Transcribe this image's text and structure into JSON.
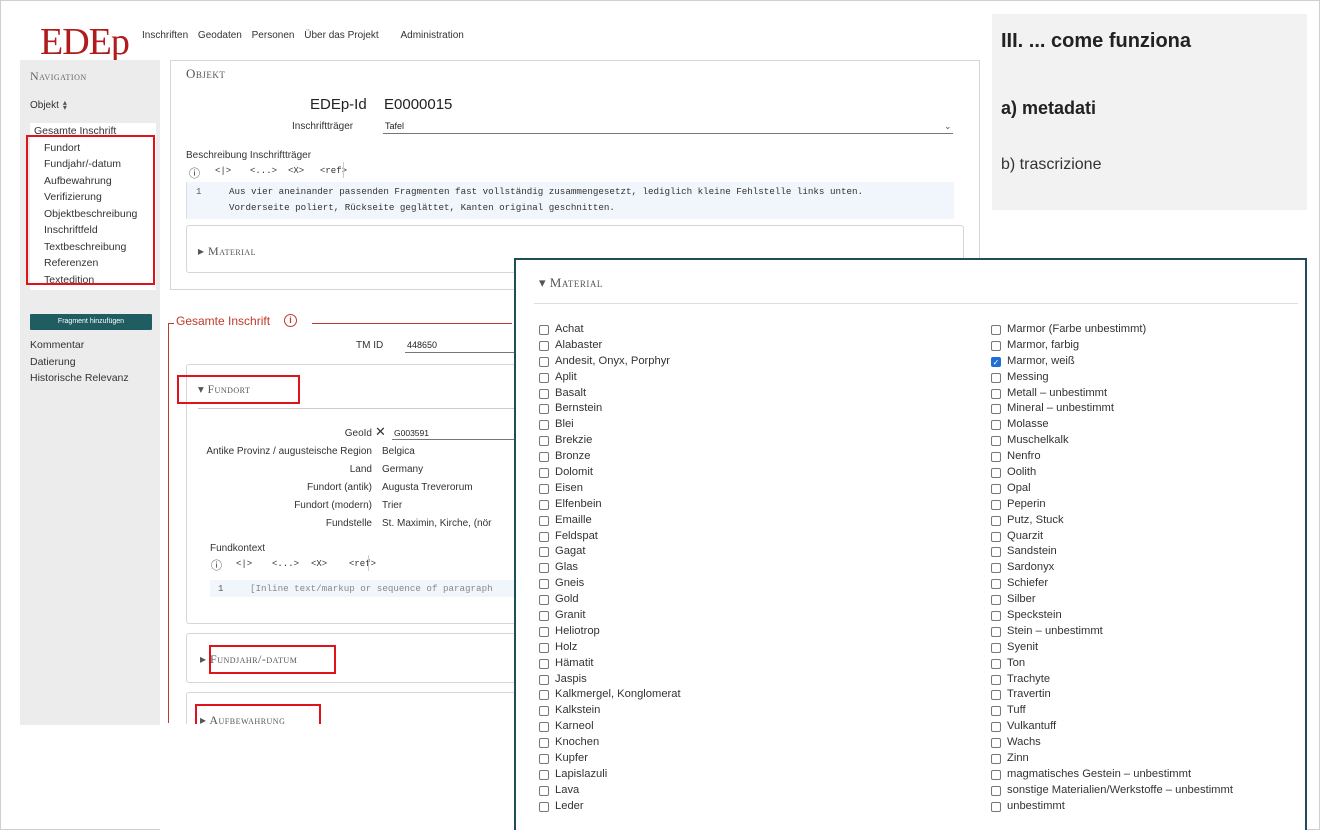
{
  "logo": "EDEp",
  "topnav": [
    "Inschriften",
    "Geodaten",
    "Personen",
    "Über das Projekt",
    "Administration"
  ],
  "sidebar": {
    "title": "Navigation",
    "select_value": "Objekt",
    "items": {
      "gesamte": "Gesamte Inschrift",
      "fundort": "Fundort",
      "fundjahr": "Fundjahr/-datum",
      "aufbewahrung": "Aufbewahrung",
      "verifizierung": "Verifizierung",
      "objektbeschreibung": "Objektbeschreibung",
      "inschriftfeld": "Inschriftfeld",
      "textbeschreibung": "Textbeschreibung",
      "referenzen": "Referenzen",
      "textedition": "Textedition"
    },
    "fragment_button": "Fragment hinzufügen",
    "more": {
      "kommentar": "Kommentar",
      "datierung": "Datierung",
      "historische": "Historische Relevanz"
    }
  },
  "objekt": {
    "title": "Objekt",
    "edep_label": "EDEp-Id",
    "edep_value": "E0000015",
    "trager_label": "Inschriftträger",
    "trager_value": "Tafel",
    "beschr_label": "Beschreibung Inschriftträger",
    "toolbar": {
      "info": "ⓘ",
      "b1": "<|>",
      "b2": "<...>",
      "b3": "<X>",
      "b4": "<ref>"
    },
    "line_no": "1",
    "line1": "Aus vier aneinander passenden Fragmenten fast vollständig zusammengesetzt, lediglich kleine Fehlstelle links unten.",
    "line2": "Vorderseite poliert, Rückseite geglättet, Kanten original geschnitten.",
    "material_label": "▸ Material"
  },
  "gesamte": {
    "title": "Gesamte Inschrift",
    "info": "i",
    "tm_label": "TM ID",
    "tm_value": "448650",
    "fundort_title": "▾ Fundort",
    "geoid_label": "GeoId",
    "geoid_x": "✕",
    "geoid_value": "G003591",
    "rows": {
      "provinz_l": "Antike Provinz / augusteische Region",
      "provinz_v": "Belgica",
      "land_l": "Land",
      "land_v": "Germany",
      "antik_l": "Fundort (antik)",
      "antik_v": "Augusta Treverorum",
      "modern_l": "Fundort (modern)",
      "modern_v": "Trier",
      "stelle_l": "Fundstelle",
      "stelle_v": "St. Maximin, Kirche, (nör"
    },
    "fundkontext_label": "Fundkontext",
    "fk_line_no": "1",
    "fk_placeholder": "[Inline text/markup or sequence of paragraph",
    "fundjahr_title": "▸ Fundjahr/-datum",
    "aufbewahrung_title": "▸ Aufbewahrung"
  },
  "right_panel": {
    "title": "III. ... come funziona",
    "a": "a)  metadati",
    "b": "b)  trascrizione"
  },
  "material_overlay": {
    "title": "▾ Material",
    "col1": [
      "Achat",
      "Alabaster",
      "Andesit, Onyx, Porphyr",
      "Aplit",
      "Basalt",
      "Bernstein",
      "Blei",
      "Brekzie",
      "Bronze",
      "Dolomit",
      "Eisen",
      "Elfenbein",
      "Emaille",
      "Feldspat",
      "Gagat",
      "Glas",
      "Gneis",
      "Gold",
      "Granit",
      "Heliotrop",
      "Holz",
      "Hämatit",
      "Jaspis",
      "Kalkmergel, Konglomerat",
      "Kalkstein",
      "Karneol",
      "Knochen",
      "Kupfer",
      "Lapislazuli",
      "Lava",
      "Leder"
    ],
    "col2": [
      "Marmor (Farbe unbestimmt)",
      "Marmor, farbig",
      "Marmor, weiß",
      "Messing",
      "Metall – unbestimmt",
      "Mineral – unbestimmt",
      "Molasse",
      "Muschelkalk",
      "Nenfro",
      "Oolith",
      "Opal",
      "Peperin",
      "Putz, Stuck",
      "Quarzit",
      "Sandstein",
      "Sardonyx",
      "Schiefer",
      "Silber",
      "Speckstein",
      "Stein – unbestimmt",
      "Syenit",
      "Ton",
      "Trachyte",
      "Travertin",
      "Tuff",
      "Vulkantuff",
      "Wachs",
      "Zinn",
      "magmatisches Gestein – unbestimmt",
      "sonstige Materialien/Werkstoffe – unbestimmt",
      "unbestimmt"
    ],
    "checked": [
      "Marmor, weiß"
    ]
  }
}
